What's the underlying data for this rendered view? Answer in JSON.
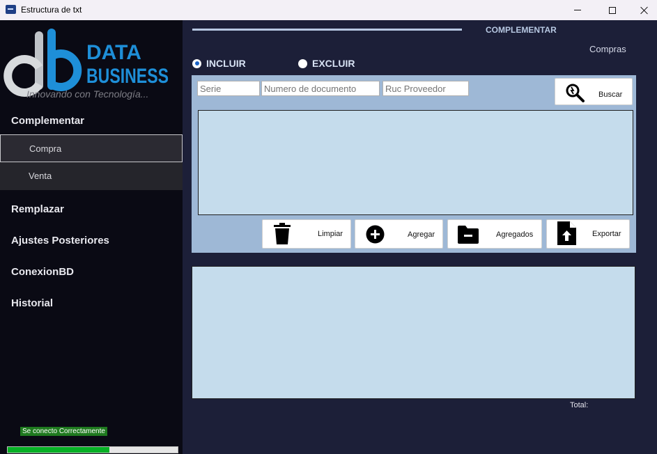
{
  "window": {
    "title": "Estructura de txt"
  },
  "sidebar": {
    "logo_text_1": "DATA",
    "logo_text_2": "BUSINESS",
    "tagline": "Innovando con Tecnología...",
    "menu": {
      "complementar": "Complementar",
      "compra": "Compra",
      "venta": "Venta",
      "remplazar": "Remplazar",
      "ajustes": "Ajustes Posteriores",
      "conexion": "ConexionBD",
      "historial": "Historial"
    },
    "status": "Se conecto Correctamente",
    "progress_percent": 60
  },
  "main": {
    "section_title": "COMPLEMENTAR",
    "subsection": "Compras",
    "radio_incluir": "INCLUIR",
    "radio_excluir": "EXCLUIR",
    "selected_radio": "incluir",
    "fields": {
      "serie_placeholder": "Serie",
      "numero_placeholder": "Numero de documento",
      "ruc_placeholder": "Ruc Proveedor"
    },
    "buttons": {
      "buscar": "Buscar",
      "limpiar": "Limpiar",
      "agregar": "Agregar",
      "agregados": "Agregados",
      "exportar": "Exportar"
    },
    "total_label": "Total:"
  },
  "colors": {
    "background": "#1c1f38",
    "sidebar": "#0a0a14",
    "panel": "#9eb8d6",
    "grid": "#c5dcec",
    "logo_blue": "#1e8fd8",
    "status_green": "#1f7a1f"
  },
  "icons": [
    "app-icon",
    "search-icon",
    "trash-icon",
    "plus-circle-icon",
    "folder-minus-icon",
    "file-upload-icon"
  ]
}
